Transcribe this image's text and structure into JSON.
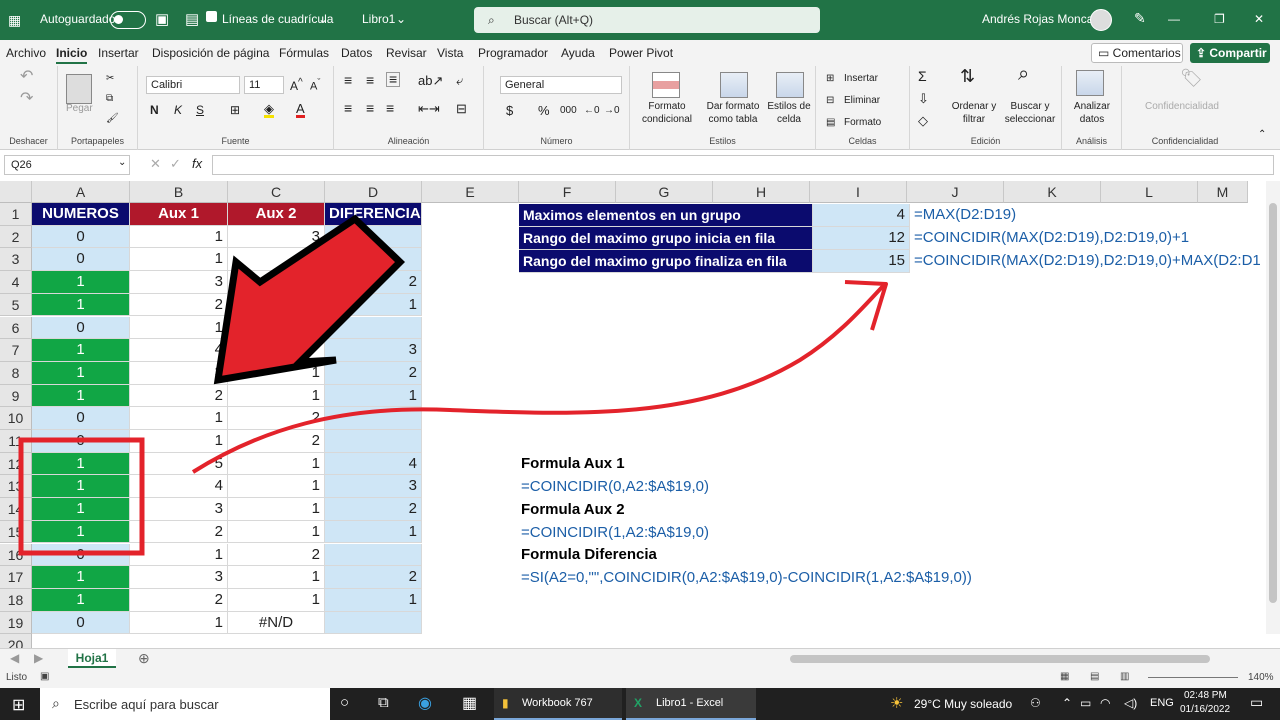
{
  "titlebar": {
    "autosave_label": "Autoguardado",
    "gridlines_label": "Líneas de cuadrícula",
    "doc_name": "Libro1",
    "search_placeholder": "Buscar (Alt+Q)",
    "user_name": "Andrés Rojas Moncada"
  },
  "menu": {
    "items": [
      "Archivo",
      "Inicio",
      "Insertar",
      "Disposición de página",
      "Fórmulas",
      "Datos",
      "Revisar",
      "Vista",
      "Programador",
      "Ayuda",
      "Power Pivot"
    ],
    "comments": "Comentarios",
    "share": "Compartir"
  },
  "ribbon": {
    "undo_group": "Deshacer",
    "clipboard": {
      "paste": "Pegar",
      "group": "Portapapeles"
    },
    "font": {
      "name": "Calibri",
      "size": "11",
      "group": "Fuente",
      "bold": "N",
      "italic": "K",
      "underline": "S"
    },
    "alignment": {
      "group": "Alineación"
    },
    "number": {
      "format": "General",
      "group": "Número",
      "currency": "$",
      "percent": "%",
      "thousands": "000"
    },
    "styles": {
      "cond_1": "Formato",
      "cond_2": "condicional",
      "table_1": "Dar formato",
      "table_2": "como tabla",
      "cell_1": "Estilos de",
      "cell_2": "celda",
      "group": "Estilos"
    },
    "cells": {
      "insert": "Insertar",
      "delete": "Eliminar",
      "format": "Formato",
      "group": "Celdas"
    },
    "editing": {
      "sort_1": "Ordenar y",
      "sort_2": "filtrar",
      "find_1": "Buscar y",
      "find_2": "seleccionar",
      "group": "Edición"
    },
    "analysis": {
      "btn_1": "Analizar",
      "btn_2": "datos",
      "group": "Análisis"
    },
    "confidential": {
      "btn": "Confidencialidad",
      "group": "Confidencialidad"
    }
  },
  "formula_bar": {
    "name_box": "Q26",
    "fx": "fx",
    "content": ""
  },
  "columns": [
    "A",
    "B",
    "C",
    "D",
    "E",
    "F",
    "G",
    "H",
    "I",
    "J",
    "K",
    "L",
    "M"
  ],
  "rows": [
    "1",
    "2",
    "3",
    "4",
    "5",
    "6",
    "7",
    "8",
    "9",
    "10",
    "11",
    "12",
    "13",
    "14",
    "15",
    "16",
    "17",
    "18",
    "19",
    "20"
  ],
  "table": {
    "headers": [
      "NUMEROS",
      "Aux 1",
      "Aux 2",
      "DIFERENCIA"
    ],
    "A": [
      "0",
      "0",
      "1",
      "1",
      "0",
      "1",
      "1",
      "1",
      "0",
      "0",
      "1",
      "1",
      "1",
      "1",
      "0",
      "1",
      "1",
      "0"
    ],
    "B": [
      "1",
      "1",
      "3",
      "2",
      "1",
      "4",
      "3",
      "2",
      "1",
      "1",
      "5",
      "4",
      "3",
      "2",
      "1",
      "3",
      "2",
      "1"
    ],
    "C": [
      "3",
      "",
      "",
      "",
      "",
      "",
      "1",
      "1",
      "2",
      "2",
      "1",
      "1",
      "1",
      "1",
      "2",
      "1",
      "1",
      "#N/D"
    ],
    "D": [
      "",
      "",
      "2",
      "1",
      "",
      "3",
      "2",
      "1",
      "",
      "",
      "4",
      "3",
      "2",
      "1",
      "",
      "2",
      "1",
      ""
    ]
  },
  "summary": {
    "labels": [
      "Maximos elementos en un grupo",
      "Rango del maximo grupo inicia en fila",
      "Rango del maximo grupo finaliza en fila"
    ],
    "values": [
      "4",
      "12",
      "15"
    ],
    "formulas": [
      "=MAX(D2:D19)",
      "=COINCIDIR(MAX(D2:D19),D2:D19,0)+1",
      "=COINCIDIR(MAX(D2:D19),D2:D19,0)+MAX(D2:D1"
    ]
  },
  "notes": {
    "aux1_title": "Formula Aux 1",
    "aux1_formula": "=COINCIDIR(0,A2:$A$19,0)",
    "aux2_title": "Formula Aux 2",
    "aux2_formula": "=COINCIDIR(1,A2:$A$19,0)",
    "diff_title": "Formula Diferencia",
    "diff_formula": "=SI(A2=0,\"\",COINCIDIR(0,A2:$A$19,0)-COINCIDIR(1,A2:$A$19,0))"
  },
  "sheet_tab": "Hoja1",
  "status": {
    "ready": "Listo",
    "zoom": "140%"
  },
  "taskbar": {
    "search": "Escribe aquí para buscar",
    "app1": "Workbook 767",
    "app2": "Libro1 - Excel",
    "weather": "29°C  Muy soleado",
    "lang": "ENG",
    "time": "02:48 PM",
    "date": "01/16/2022"
  },
  "colors": {
    "excel_green": "#217346",
    "header_navy": "#0b0b6e",
    "header_red": "#b0182b",
    "green_cell": "#11a645",
    "light_blue": "#cfe6f6",
    "annotation_red": "#e3232b"
  }
}
